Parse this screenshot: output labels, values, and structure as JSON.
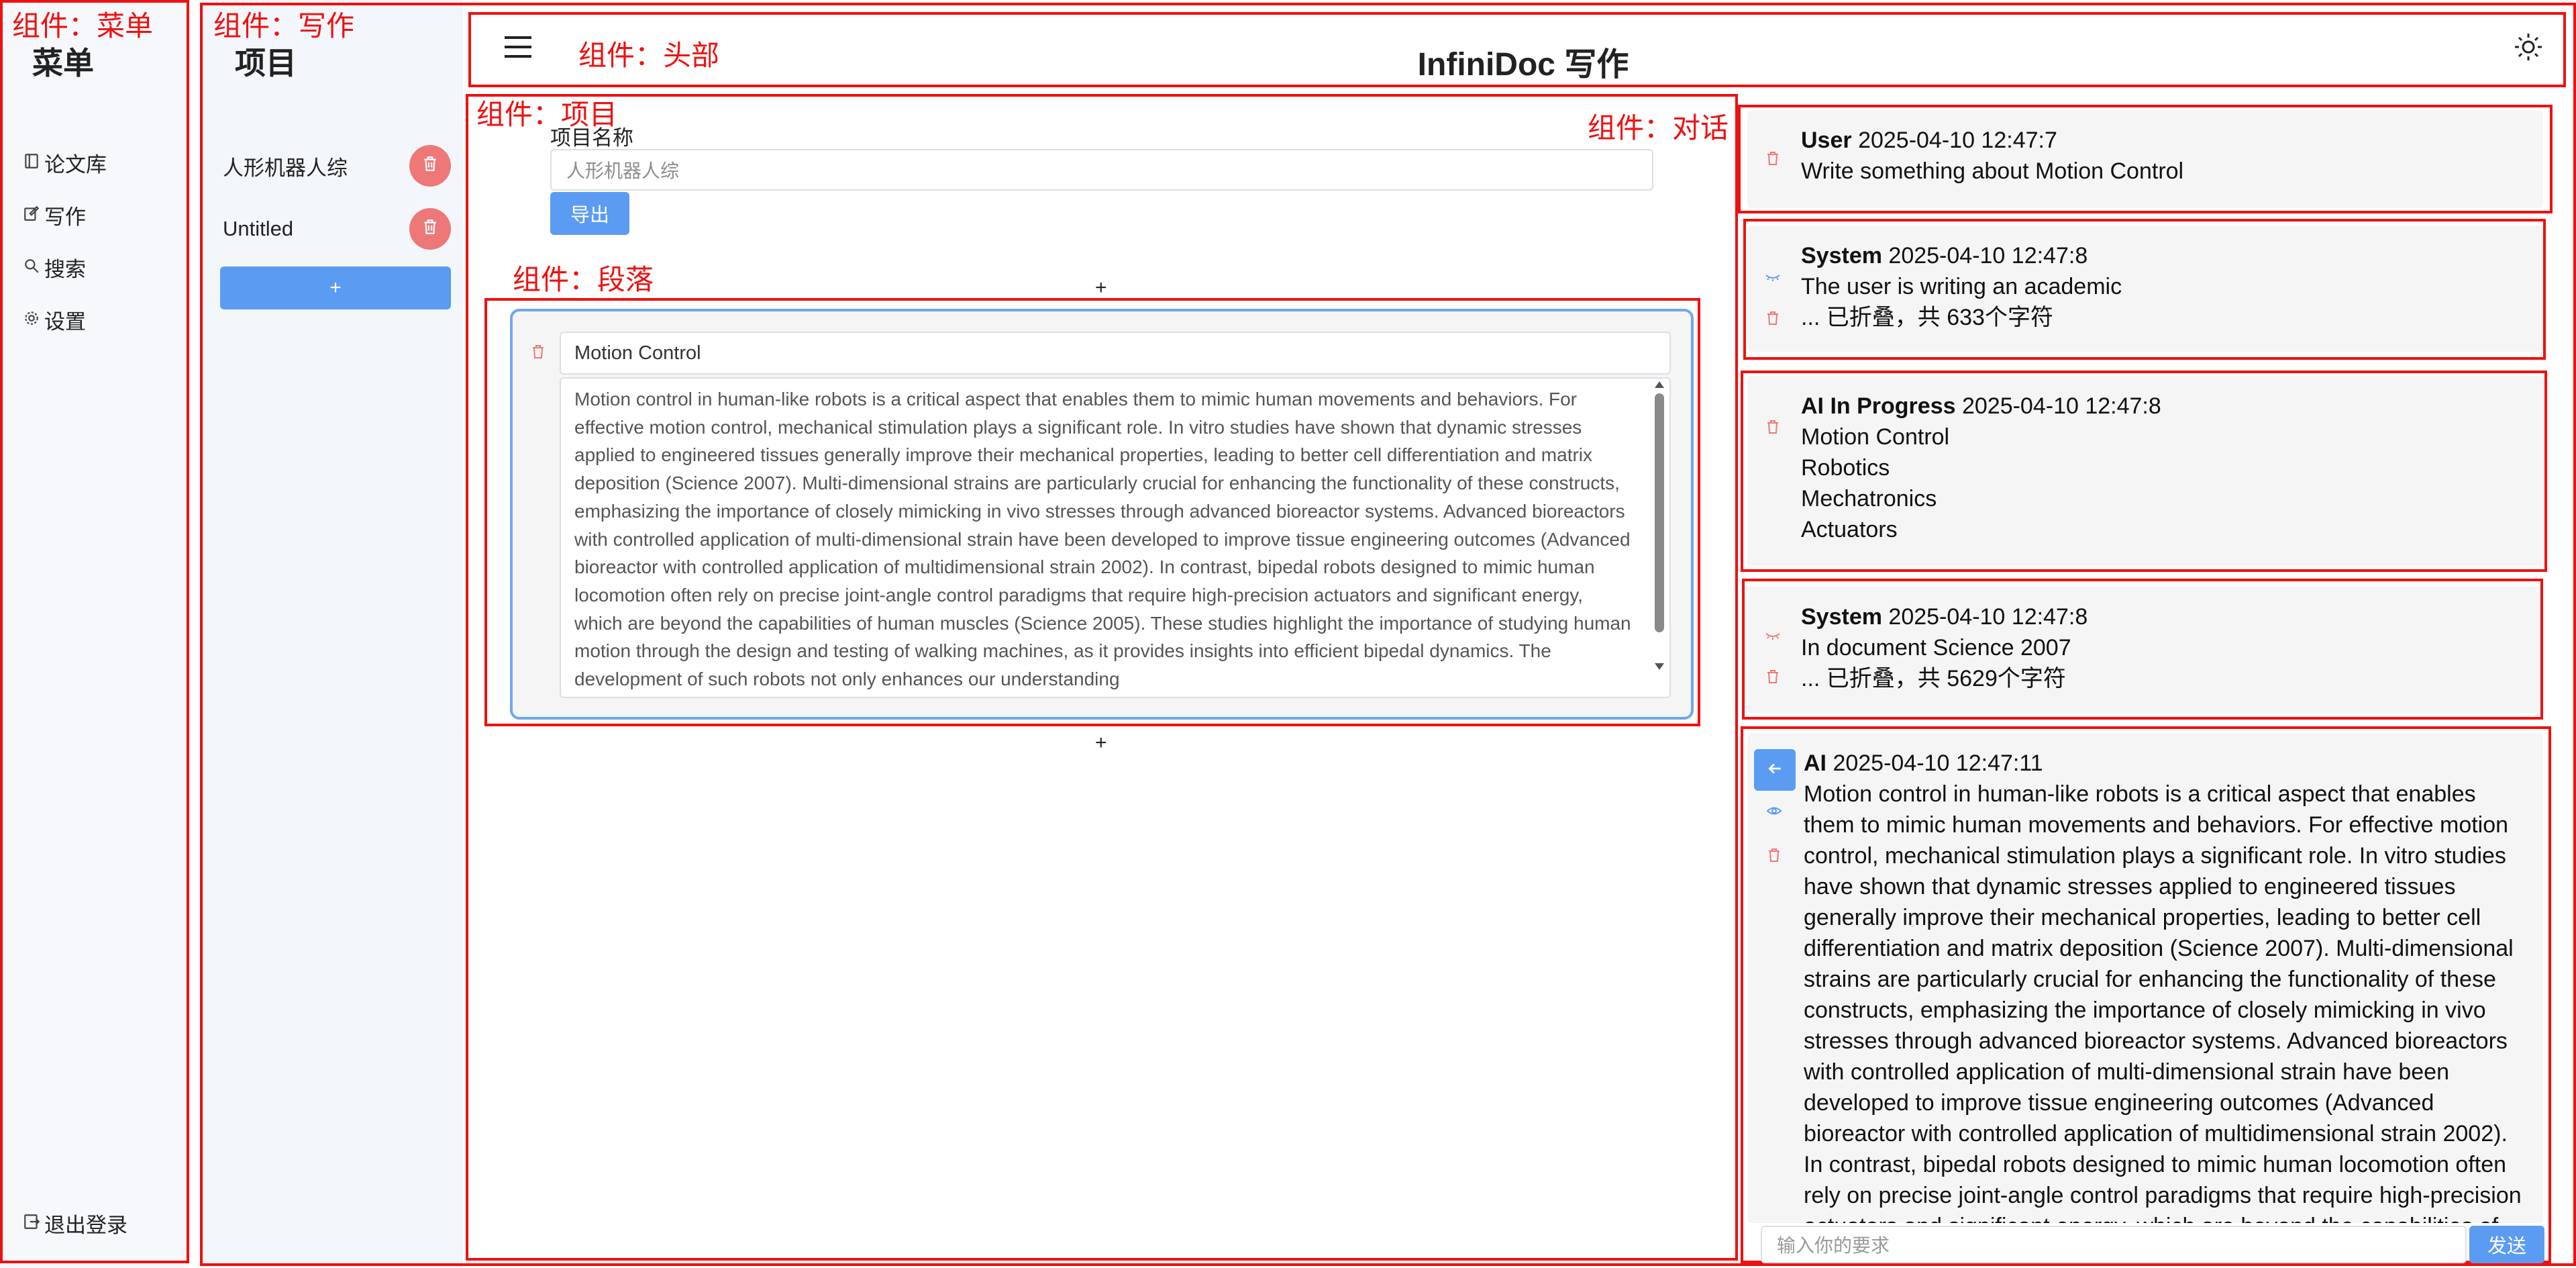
{
  "annotations": {
    "menu": "组件：菜单",
    "writing": "组件：写作",
    "header": "组件：头部",
    "project": "组件：项目",
    "conversation": "组件：对话",
    "paragraph": "组件：段落"
  },
  "menu": {
    "title": "菜单",
    "items": [
      {
        "label": "论文库",
        "icon": "book-icon"
      },
      {
        "label": "写作",
        "icon": "edit-icon"
      },
      {
        "label": "搜索",
        "icon": "search-icon"
      },
      {
        "label": "设置",
        "icon": "gear-icon"
      }
    ],
    "logout": "退出登录"
  },
  "writing": {
    "title": "项目",
    "projects": [
      "人形机器人综",
      "Untitled"
    ],
    "add_label": "+"
  },
  "header": {
    "title": "InfiniDoc 写作",
    "menu_icon": "hamburger-icon",
    "theme_icon": "sun-icon"
  },
  "project": {
    "name_label": "项目名称",
    "name_value": "人形机器人综",
    "export_label": "导出",
    "plus": "+"
  },
  "paragraph": {
    "title": "Motion Control",
    "text": "Motion control in human-like robots is a critical aspect that enables them to mimic human movements and behaviors. For effective motion control, mechanical stimulation plays a significant role. In vitro studies have shown that dynamic stresses applied to engineered tissues generally improve their mechanical properties, leading to better cell differentiation and matrix deposition (Science 2007). Multi-dimensional strains are particularly crucial for enhancing the functionality of these constructs, emphasizing the importance of closely mimicking in vivo stresses through advanced bioreactor systems. Advanced bioreactors with controlled application of multi-dimensional strain have been developed to improve tissue engineering outcomes (Advanced bioreactor with controlled application of multidimensional strain 2002). In contrast, bipedal robots designed to mimic human locomotion often rely on precise joint-angle control paradigms that require high-precision actuators and significant energy, which are beyond the capabilities of human muscles (Science 2005). These studies highlight the importance of studying human motion through the design and testing of walking machines, as it provides insights into efficient bipedal dynamics. The development of such robots not only enhances our understanding"
  },
  "conversation": {
    "messages": [
      {
        "role": "User",
        "time": "2025-04-10 12:47:7",
        "lines": [
          "Write something about Motion Control"
        ]
      },
      {
        "role": "System",
        "time": "2025-04-10 12:47:8",
        "lines": [
          "The user is writing an academic",
          "... 已折叠，共 633个字符"
        ]
      },
      {
        "role": "AI In Progress",
        "time": "2025-04-10 12:47:8",
        "lines": [
          "Motion Control",
          "Robotics",
          "Mechatronics",
          "Actuators"
        ]
      },
      {
        "role": "System",
        "time": "2025-04-10 12:47:8",
        "lines": [
          "In document Science 2007",
          "... 已折叠，共 5629个字符"
        ]
      },
      {
        "role": "AI",
        "time": "2025-04-10 12:47:11",
        "text": "Motion control in human-like robots is a critical aspect that enables them to mimic human movements and behaviors. For effective motion control, mechanical stimulation plays a significant role. In vitro studies have shown that dynamic stresses applied to engineered tissues generally improve their mechanical properties, leading to better cell differentiation and matrix deposition (Science 2007). Multi-dimensional strains are particularly crucial for enhancing the functionality of these constructs, emphasizing the importance of closely mimicking in vivo stresses through advanced bioreactor systems. Advanced bioreactors with controlled application of multi-dimensional strain have been developed to improve tissue engineering outcomes (Advanced bioreactor with controlled application of multidimensional strain 2002). In contrast, bipedal robots designed to mimic human locomotion often rely on precise joint-angle control paradigms that require high-precision actuators and significant energy, which are beyond the capabilities of human muscles"
      }
    ],
    "input_placeholder": "输入你的要求",
    "send_label": "发送"
  },
  "colors": {
    "annotation_red": "#ee1111",
    "primary_blue": "#5b9cf2",
    "delete_red": "#ee7878"
  }
}
